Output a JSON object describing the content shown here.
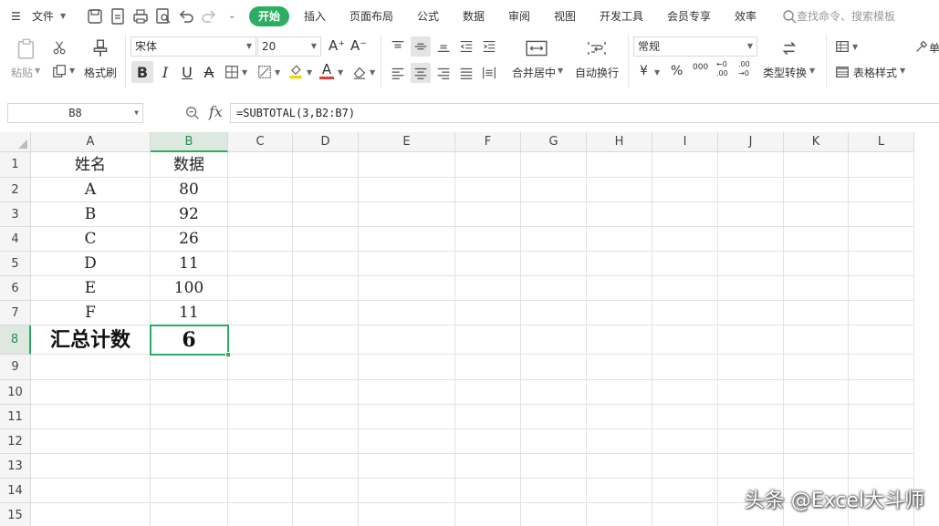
{
  "menubar": {
    "file_label": "文件",
    "tabs": [
      "开始",
      "插入",
      "页面布局",
      "公式",
      "数据",
      "审阅",
      "视图",
      "开发工具",
      "会员专享",
      "效率"
    ],
    "search_placeholder": "查找命令、搜索模板"
  },
  "ribbon": {
    "paste_label": "粘贴",
    "format_painter_label": "格式刷",
    "font_name": "宋体",
    "font_size": "20",
    "merge_label": "合并居中",
    "wrap_label": "自动换行",
    "number_format": "常规",
    "type_convert_label": "类型转换",
    "table_style_label": "表格样式",
    "currency_symbol": "¥",
    "percent_symbol": "%",
    "thousands_symbol": "000",
    "decimal_inc": "←0 .00",
    "decimal_dec": ".00 →0",
    "bold_glyph": "B",
    "italic_glyph": "I",
    "underline_glyph": "U",
    "strike_glyph": "A",
    "font_color_glyph": "A",
    "grow_font_glyph": "A⁺",
    "shrink_font_glyph": "A⁻",
    "partial_label": "单"
  },
  "formula_bar": {
    "name_box": "B8",
    "fx_label": "fx",
    "formula": "=SUBTOTAL(3,B2:B7)"
  },
  "sheet": {
    "columns": [
      "A",
      "B",
      "C",
      "D",
      "E",
      "F",
      "G",
      "H",
      "I",
      "J",
      "K",
      "L"
    ],
    "rows": [
      "1",
      "2",
      "3",
      "4",
      "5",
      "6",
      "7",
      "8",
      "9",
      "10",
      "11",
      "12",
      "13",
      "14",
      "15"
    ],
    "selected_cell": "B8",
    "cells": [
      {
        "ref": "A1",
        "value": "姓名"
      },
      {
        "ref": "B1",
        "value": "数据"
      },
      {
        "ref": "A2",
        "value": "A"
      },
      {
        "ref": "B2",
        "value": "80"
      },
      {
        "ref": "A3",
        "value": "B"
      },
      {
        "ref": "B3",
        "value": "92"
      },
      {
        "ref": "A4",
        "value": "C"
      },
      {
        "ref": "B4",
        "value": "26"
      },
      {
        "ref": "A5",
        "value": "D"
      },
      {
        "ref": "B5",
        "value": "11"
      },
      {
        "ref": "A6",
        "value": "E"
      },
      {
        "ref": "B6",
        "value": "100"
      },
      {
        "ref": "A7",
        "value": "F"
      },
      {
        "ref": "B7",
        "value": "11"
      },
      {
        "ref": "A8",
        "value": "汇总计数",
        "bold": true
      },
      {
        "ref": "B8",
        "value": "6",
        "bold": true
      }
    ]
  },
  "watermark": "头条 @Excel大斗师",
  "colors": {
    "accent": "#2bae62",
    "header_bg": "#f5f5f5",
    "gridline": "#e2e2e2"
  }
}
